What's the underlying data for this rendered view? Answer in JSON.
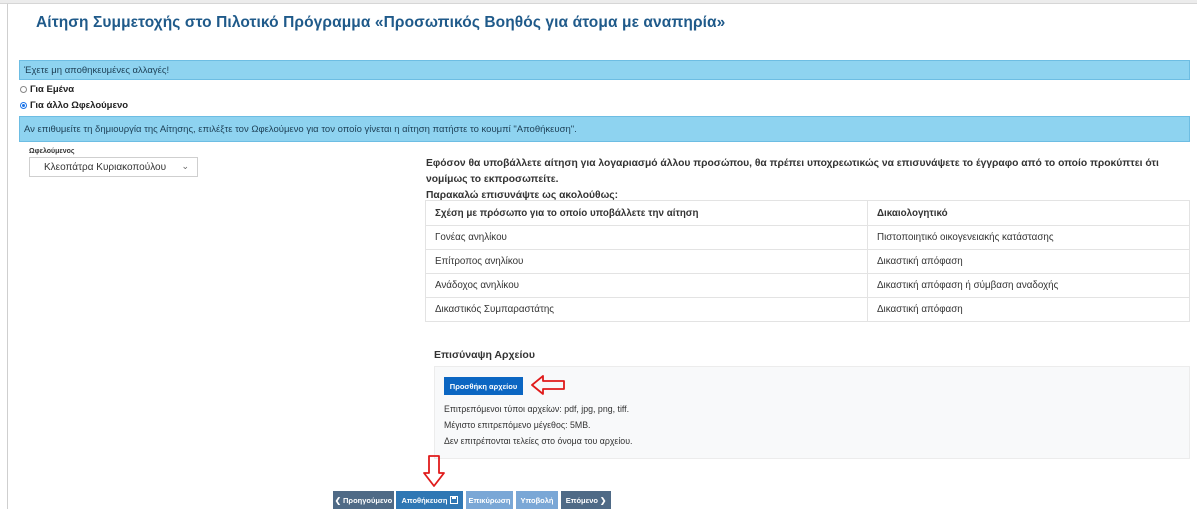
{
  "page": {
    "title": "Αίτηση Συμμετοχής στο Πιλοτικό Πρόγραμμα «Προσωπικός Βοηθός για άτομα με αναπηρία»"
  },
  "alerts": {
    "unsaved": "Έχετε μη αποθηκευμένες αλλαγές!",
    "info": "Αν επιθυμείτε τη δημιουργία της Αίτησης, επιλέξτε τον Ωφελούμενο για τον οποίο γίνεται η αίτηση πατήστε το κουμπί \"Αποθήκευση\"."
  },
  "applicant_options": [
    {
      "label": "Για Εμένα",
      "checked": false
    },
    {
      "label": "Για άλλο Ωφελούμενο",
      "checked": true
    }
  ],
  "beneficiary": {
    "label": "Ωφελούμενος",
    "selected": "Κλεοπάτρα Κυριακοπούλου"
  },
  "notice": {
    "line1": "Εφόσον θα υποβάλλετε αίτηση για λογαριασμό άλλου προσώπου, θα πρέπει υποχρεωτικώς να επισυνάψετε το έγγραφο από το οποίο προκύπτει ότι νομίμως το εκπροσωπείτε.",
    "line2": "Παρακαλώ επισυνάψτε ως ακολούθως:"
  },
  "documents_table": {
    "headers": [
      "Σχέση με πρόσωπο για το οποίο υποβάλλετε την αίτηση",
      "Δικαιολογητικό"
    ],
    "rows": [
      [
        "Γονέας ανηλίκου",
        "Πιστοποιητικό οικογενειακής κατάστασης"
      ],
      [
        "Επίτροπος ανηλίκου",
        "Δικαστική απόφαση"
      ],
      [
        "Ανάδοχος ανηλίκου",
        "Δικαστική απόφαση ή σύμβαση αναδοχής"
      ],
      [
        "Δικαστικός Συμπαραστάτης",
        "Δικαστική απόφαση"
      ]
    ]
  },
  "attachment": {
    "title": "Επισύναψη Αρχείου",
    "add_button": "Προσθήκη αρχείου",
    "hint_types": "Επιτρεπόμενοι τύποι αρχείων: pdf, jpg, png, tiff.",
    "hint_size": "Μέγιστο επιτρεπόμενο μέγεθος: 5MB.",
    "hint_dots": "Δεν επιτρέπονται τελείες στο όνομα του αρχείου."
  },
  "navigation": {
    "prev": "Προηγούμενο",
    "save": "Αποθήκευση",
    "confirm": "Επικύρωση",
    "submit": "Υποβολή",
    "next": "Επόμενο"
  },
  "colors": {
    "title": "#1f5a8a",
    "alert_bg": "#8ed3f0",
    "primary_button": "#0b66c2",
    "annotation_arrow": "#e01b1b"
  }
}
